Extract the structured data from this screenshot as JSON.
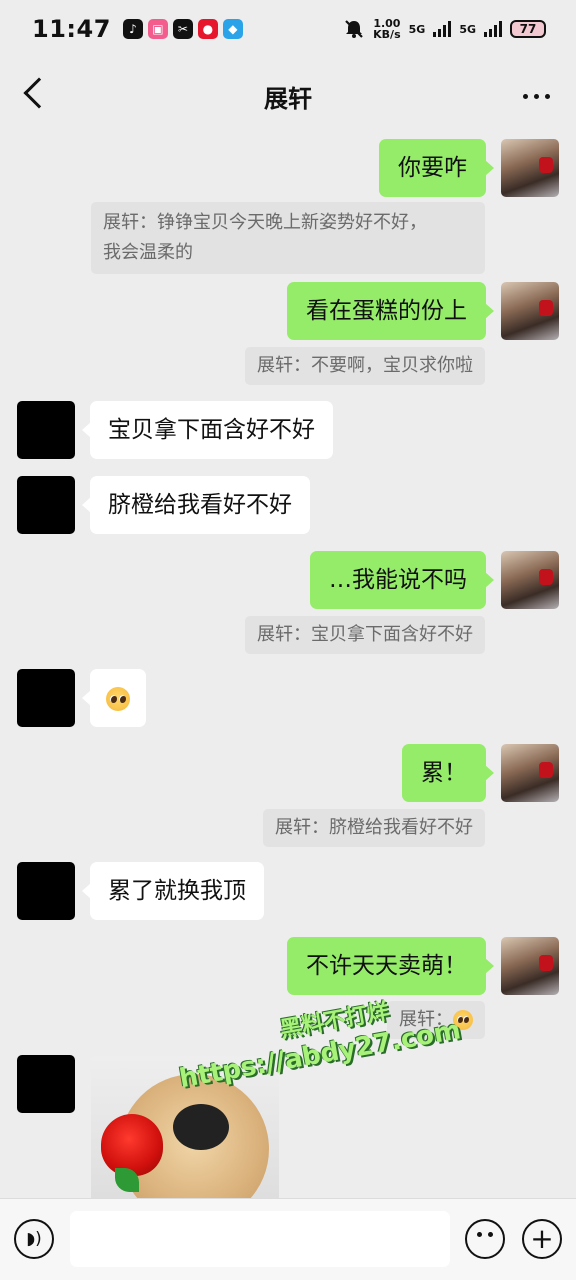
{
  "status_bar": {
    "time": "11:47",
    "net_speed_value": "1.00",
    "net_speed_unit": "KB/s",
    "sim1": "5G",
    "sim2": "5G",
    "battery": "77",
    "icons": [
      "tiktok-icon",
      "bilibili-icon",
      "capcut-icon",
      "weibo-icon",
      "app-icon",
      "mute-icon"
    ]
  },
  "nav": {
    "title": "展轩",
    "back_icon": "chevron-left-icon",
    "more_icon": "more-dots-icon"
  },
  "messages": [
    {
      "side": "right",
      "text": "你要咋"
    },
    {
      "type": "quote",
      "text": "展轩：铮铮宝贝今天晚上新姿势好不好，\n我会温柔的"
    },
    {
      "side": "right",
      "text": "看在蛋糕的份上"
    },
    {
      "type": "quote",
      "text": "展轩：不要啊，宝贝求你啦"
    },
    {
      "side": "left",
      "text": "宝贝拿下面含好不好"
    },
    {
      "side": "left",
      "text": "脐橙给我看好不好"
    },
    {
      "side": "right",
      "text": "…我能说不吗"
    },
    {
      "type": "quote",
      "text": "展轩：宝贝拿下面含好不好"
    },
    {
      "side": "left",
      "emoji": "pleading-face-emoji"
    },
    {
      "side": "right",
      "text": "累！"
    },
    {
      "type": "quote",
      "text": "展轩：脐橙给我看好不好"
    },
    {
      "side": "left",
      "text": "累了就换我顶"
    },
    {
      "side": "right",
      "text": "不许天天卖萌！"
    },
    {
      "type": "quote",
      "text": "展轩：",
      "emoji": "pleading-face-emoji"
    },
    {
      "side": "left",
      "image": "puppy-with-rose-sticker"
    }
  ],
  "watermark": {
    "line1": "黑料不打烊",
    "line2": "https://abdy27.com"
  },
  "input_bar": {
    "voice_icon": "voice-icon",
    "emoji_icon": "emoji-icon",
    "plus_icon": "plus-icon",
    "value": ""
  }
}
